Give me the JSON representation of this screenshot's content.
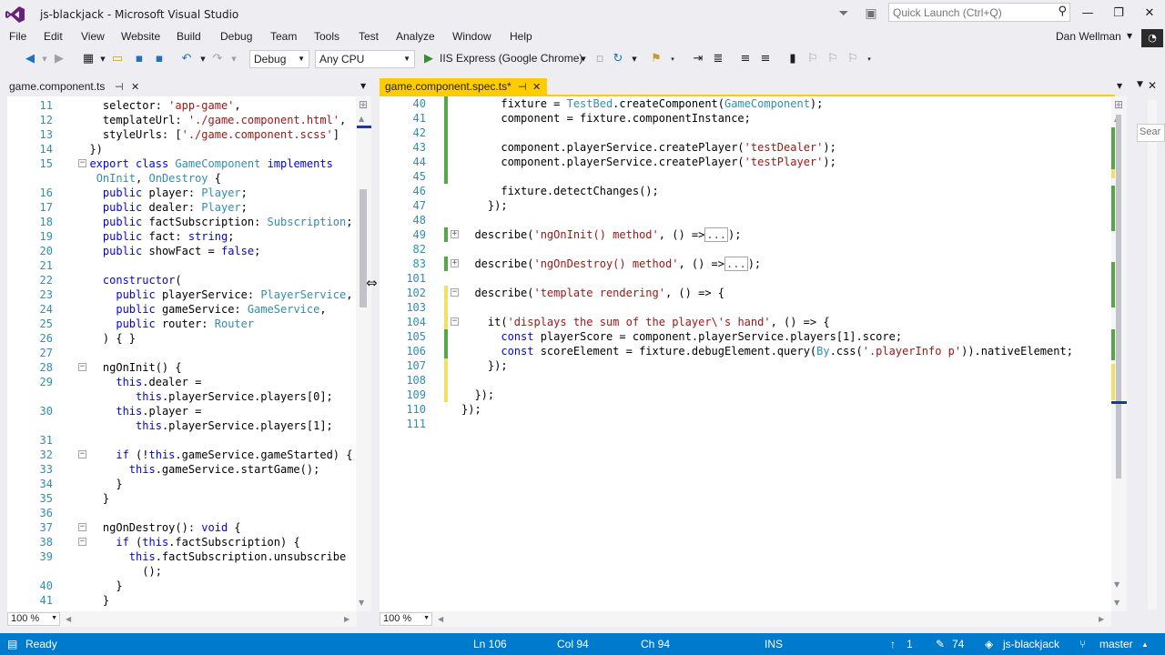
{
  "window": {
    "title": "js-blackjack - Microsoft Visual Studio",
    "quick_launch_placeholder": "Quick Launch (Ctrl+Q)",
    "controls": {
      "minimize": "—",
      "restore": "❐",
      "close": "✕"
    }
  },
  "menu": {
    "items": [
      "File",
      "Edit",
      "View",
      "Website",
      "Build",
      "Debug",
      "Team",
      "Tools",
      "Test",
      "Analyze",
      "Window",
      "Help"
    ],
    "user": "Dan Wellman"
  },
  "toolbar": {
    "config": "Debug",
    "platform": "Any CPU",
    "run_target": "IIS Express (Google Chrome)"
  },
  "left_pane": {
    "tab_label": "game.component.ts",
    "zoom": "100 %",
    "lines": [
      {
        "n": "11",
        "segs": [
          [
            "    selector: ",
            ""
          ],
          [
            "'app-game'",
            "str"
          ],
          [
            ",",
            ""
          ]
        ]
      },
      {
        "n": "12",
        "segs": [
          [
            "    templateUrl: ",
            ""
          ],
          [
            "'./game.component.html'",
            "str"
          ],
          [
            ",",
            ""
          ]
        ]
      },
      {
        "n": "13",
        "segs": [
          [
            "    styleUrls: [",
            ""
          ],
          [
            "'./game.component.scss'",
            "str"
          ],
          [
            "]",
            ""
          ]
        ]
      },
      {
        "n": "14",
        "segs": [
          [
            "  })",
            ""
          ]
        ]
      },
      {
        "n": "15",
        "segs": [
          [
            "  ",
            ""
          ],
          [
            "export",
            "kw"
          ],
          [
            " ",
            ""
          ],
          [
            "class",
            "kw"
          ],
          [
            " ",
            ""
          ],
          [
            "GameComponent",
            "typ"
          ],
          [
            " ",
            ""
          ],
          [
            "implements",
            "kw"
          ]
        ]
      },
      {
        "n": "",
        "segs": [
          [
            "   ",
            ""
          ],
          [
            "OnInit",
            "typ"
          ],
          [
            ", ",
            ""
          ],
          [
            "OnDestroy",
            "typ"
          ],
          [
            " {",
            ""
          ]
        ]
      },
      {
        "n": "16",
        "segs": [
          [
            "    ",
            ""
          ],
          [
            "public",
            "kw"
          ],
          [
            " player: ",
            ""
          ],
          [
            "Player",
            "typ"
          ],
          [
            ";",
            ""
          ]
        ]
      },
      {
        "n": "17",
        "segs": [
          [
            "    ",
            ""
          ],
          [
            "public",
            "kw"
          ],
          [
            " dealer: ",
            ""
          ],
          [
            "Player",
            "typ"
          ],
          [
            ";",
            ""
          ]
        ]
      },
      {
        "n": "18",
        "segs": [
          [
            "    ",
            ""
          ],
          [
            "public",
            "kw"
          ],
          [
            " factSubscription: ",
            ""
          ],
          [
            "Subscription",
            "typ"
          ],
          [
            ";",
            ""
          ]
        ]
      },
      {
        "n": "19",
        "segs": [
          [
            "    ",
            ""
          ],
          [
            "public",
            "kw"
          ],
          [
            " fact: ",
            ""
          ],
          [
            "string",
            "kw"
          ],
          [
            ";",
            ""
          ]
        ]
      },
      {
        "n": "20",
        "segs": [
          [
            "    ",
            ""
          ],
          [
            "public",
            "kw"
          ],
          [
            " showFact = ",
            ""
          ],
          [
            "false",
            "kw"
          ],
          [
            ";",
            ""
          ]
        ]
      },
      {
        "n": "21",
        "segs": [
          [
            "",
            ""
          ]
        ]
      },
      {
        "n": "22",
        "segs": [
          [
            "    ",
            ""
          ],
          [
            "constructor",
            "kw"
          ],
          [
            "(",
            ""
          ]
        ]
      },
      {
        "n": "23",
        "segs": [
          [
            "      ",
            ""
          ],
          [
            "public",
            "kw"
          ],
          [
            " playerService: ",
            ""
          ],
          [
            "PlayerService",
            "typ"
          ],
          [
            ",",
            ""
          ]
        ]
      },
      {
        "n": "24",
        "segs": [
          [
            "      ",
            ""
          ],
          [
            "public",
            "kw"
          ],
          [
            " gameService: ",
            ""
          ],
          [
            "GameService",
            "typ"
          ],
          [
            ",",
            ""
          ]
        ]
      },
      {
        "n": "25",
        "segs": [
          [
            "      ",
            ""
          ],
          [
            "public",
            "kw"
          ],
          [
            " router: ",
            ""
          ],
          [
            "Router",
            "typ"
          ]
        ]
      },
      {
        "n": "26",
        "segs": [
          [
            "    ) { }",
            ""
          ]
        ]
      },
      {
        "n": "27",
        "segs": [
          [
            "",
            ""
          ]
        ]
      },
      {
        "n": "28",
        "segs": [
          [
            "    ngOnInit() {",
            ""
          ]
        ]
      },
      {
        "n": "29",
        "segs": [
          [
            "      ",
            ""
          ],
          [
            "this",
            "kw"
          ],
          [
            ".dealer =",
            ""
          ]
        ]
      },
      {
        "n": "",
        "segs": [
          [
            "         ",
            ""
          ],
          [
            "this",
            "kw"
          ],
          [
            ".playerService.players[0];",
            ""
          ]
        ]
      },
      {
        "n": "30",
        "segs": [
          [
            "      ",
            ""
          ],
          [
            "this",
            "kw"
          ],
          [
            ".player =",
            ""
          ]
        ]
      },
      {
        "n": "",
        "segs": [
          [
            "         ",
            ""
          ],
          [
            "this",
            "kw"
          ],
          [
            ".playerService.players[1];",
            ""
          ]
        ]
      },
      {
        "n": "31",
        "segs": [
          [
            "",
            ""
          ]
        ]
      },
      {
        "n": "32",
        "segs": [
          [
            "      ",
            ""
          ],
          [
            "if",
            "kw"
          ],
          [
            " (!",
            ""
          ],
          [
            "this",
            "kw"
          ],
          [
            ".gameService.gameStarted) {",
            ""
          ]
        ]
      },
      {
        "n": "33",
        "segs": [
          [
            "        ",
            ""
          ],
          [
            "this",
            "kw"
          ],
          [
            ".gameService.startGame();",
            ""
          ]
        ]
      },
      {
        "n": "34",
        "segs": [
          [
            "      }",
            ""
          ]
        ]
      },
      {
        "n": "35",
        "segs": [
          [
            "    }",
            ""
          ]
        ]
      },
      {
        "n": "36",
        "segs": [
          [
            "",
            ""
          ]
        ]
      },
      {
        "n": "37",
        "segs": [
          [
            "    ngOnDestroy(): ",
            ""
          ],
          [
            "void",
            "kw"
          ],
          [
            " {",
            ""
          ]
        ]
      },
      {
        "n": "38",
        "segs": [
          [
            "      ",
            ""
          ],
          [
            "if",
            "kw"
          ],
          [
            " (",
            ""
          ],
          [
            "this",
            "kw"
          ],
          [
            ".factSubscription) {",
            ""
          ]
        ]
      },
      {
        "n": "39",
        "segs": [
          [
            "        ",
            ""
          ],
          [
            "this",
            "kw"
          ],
          [
            ".factSubscription.unsubscribe",
            ""
          ]
        ]
      },
      {
        "n": "",
        "segs": [
          [
            "          ();",
            ""
          ]
        ]
      },
      {
        "n": "40",
        "segs": [
          [
            "      }",
            ""
          ]
        ]
      },
      {
        "n": "41",
        "segs": [
          [
            "    }",
            ""
          ]
        ]
      }
    ]
  },
  "right_pane": {
    "tab_label": "game.component.spec.ts*",
    "zoom": "100 %",
    "lines": [
      {
        "n": "40",
        "segs": [
          [
            "      fixture = ",
            ""
          ],
          [
            "TestBed",
            "typ"
          ],
          [
            ".createComponent(",
            ""
          ],
          [
            "GameComponent",
            "typ"
          ],
          [
            ");",
            ""
          ]
        ]
      },
      {
        "n": "41",
        "segs": [
          [
            "      component = fixture.componentInstance;",
            ""
          ]
        ]
      },
      {
        "n": "42",
        "segs": [
          [
            "",
            ""
          ]
        ]
      },
      {
        "n": "43",
        "segs": [
          [
            "      component.playerService.createPlayer(",
            ""
          ],
          [
            "'testDealer'",
            "str"
          ],
          [
            ");",
            ""
          ]
        ]
      },
      {
        "n": "44",
        "segs": [
          [
            "      component.playerService.createPlayer(",
            ""
          ],
          [
            "'testPlayer'",
            "str"
          ],
          [
            ");",
            ""
          ]
        ]
      },
      {
        "n": "45",
        "segs": [
          [
            "",
            ""
          ]
        ]
      },
      {
        "n": "46",
        "segs": [
          [
            "      fixture.detectChanges();",
            ""
          ]
        ]
      },
      {
        "n": "47",
        "segs": [
          [
            "    });",
            ""
          ]
        ]
      },
      {
        "n": "48",
        "segs": [
          [
            "",
            ""
          ]
        ]
      },
      {
        "n": "49",
        "segs": [
          [
            "  describe(",
            ""
          ],
          [
            "'ngOnInit() method'",
            "str"
          ],
          [
            ", () =>",
            ""
          ],
          [
            "...",
            "box"
          ],
          [
            ");",
            ""
          ]
        ]
      },
      {
        "n": "82",
        "segs": [
          [
            "",
            ""
          ]
        ]
      },
      {
        "n": "83",
        "segs": [
          [
            "  describe(",
            ""
          ],
          [
            "'ngOnDestroy() method'",
            "str"
          ],
          [
            ", () =>",
            ""
          ],
          [
            "...",
            "box"
          ],
          [
            ");",
            ""
          ]
        ]
      },
      {
        "n": "101",
        "segs": [
          [
            "",
            ""
          ]
        ]
      },
      {
        "n": "102",
        "segs": [
          [
            "  describe(",
            ""
          ],
          [
            "'template rendering'",
            "str"
          ],
          [
            ", () => {",
            ""
          ]
        ]
      },
      {
        "n": "103",
        "segs": [
          [
            "",
            ""
          ]
        ]
      },
      {
        "n": "104",
        "segs": [
          [
            "    it(",
            ""
          ],
          [
            "'displays the sum of the player\\'s hand'",
            "str"
          ],
          [
            ", () => {",
            ""
          ]
        ]
      },
      {
        "n": "105",
        "segs": [
          [
            "      ",
            ""
          ],
          [
            "const",
            "kw"
          ],
          [
            " playerScore = component.playerService.players[1].score;",
            ""
          ]
        ]
      },
      {
        "n": "106",
        "segs": [
          [
            "      ",
            ""
          ],
          [
            "const",
            "kw"
          ],
          [
            " scoreElement = fixture.debugElement.query(",
            ""
          ],
          [
            "By",
            "typ"
          ],
          [
            ".css(",
            ""
          ],
          [
            "'.playerInfo p'",
            "str"
          ],
          [
            ")).nativeElement;",
            ""
          ]
        ]
      },
      {
        "n": "107",
        "segs": [
          [
            "    });",
            ""
          ]
        ]
      },
      {
        "n": "108",
        "segs": [
          [
            "",
            ""
          ]
        ]
      },
      {
        "n": "109",
        "segs": [
          [
            "  });",
            ""
          ]
        ]
      },
      {
        "n": "110",
        "segs": [
          [
            "});",
            ""
          ]
        ]
      },
      {
        "n": "111",
        "segs": [
          [
            "",
            ""
          ]
        ]
      }
    ]
  },
  "side_search_placeholder": "Sear",
  "status": {
    "ready": "Ready",
    "ln": "Ln 106",
    "col": "Col 94",
    "ch": "Ch 94",
    "ins": "INS",
    "up_count": "1",
    "edit_count": "74",
    "repo": "js-blackjack",
    "branch": "master"
  },
  "colors": {
    "accent_blue": "#007acc",
    "active_tab": "#ffcc00",
    "keyword": "#0000ff",
    "string": "#a31515",
    "type": "#2b91af",
    "line_number": "#2b91af"
  }
}
